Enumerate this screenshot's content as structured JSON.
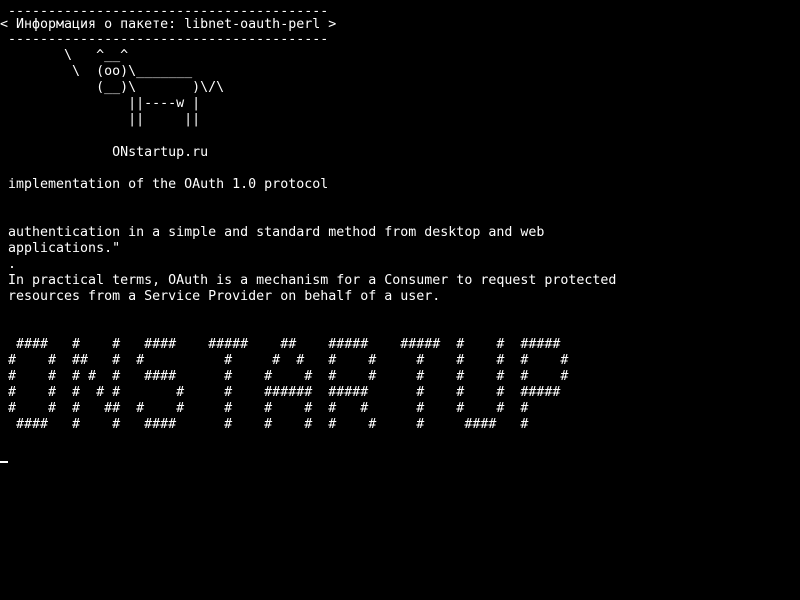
{
  "colors": {
    "background": "#000000",
    "foreground": "#ffffff"
  },
  "terminal": {
    "lines": [
      " ---------------------------------------- ",
      "< Информация о пакете: libnet-oauth-perl >",
      " ---------------------------------------- ",
      "        \\   ^__^",
      "         \\  (oo)\\_______",
      "            (__)\\       )\\/\\",
      "                ||----w |",
      "                ||     ||",
      "",
      "              ONstartup.ru",
      "",
      " implementation of the OAuth 1.0 protocol",
      "",
      "",
      " authentication in a simple and standard method from desktop and web",
      " applications.\"",
      " .",
      " In practical terms, OAuth is a mechanism for a Consumer to request protected",
      " resources from a Service Provider on behalf of a user.",
      "",
      "",
      "  ####   #    #   ####    #####    ##    #####    #####  #    #  #####",
      " #    #  ##   #  #          #     #  #   #    #     #    #    #  #    #",
      " #    #  # #  #   ####      #    #    #  #    #     #    #    #  #    #",
      " #    #  #  # #       #     #    ######  #####      #    #    #  #####",
      " #    #  #   ##  #    #     #    #    #  #   #      #    #    #  #",
      "  ####   #    #   ####      #    #    #  #    #     #     ####   #"
    ]
  }
}
